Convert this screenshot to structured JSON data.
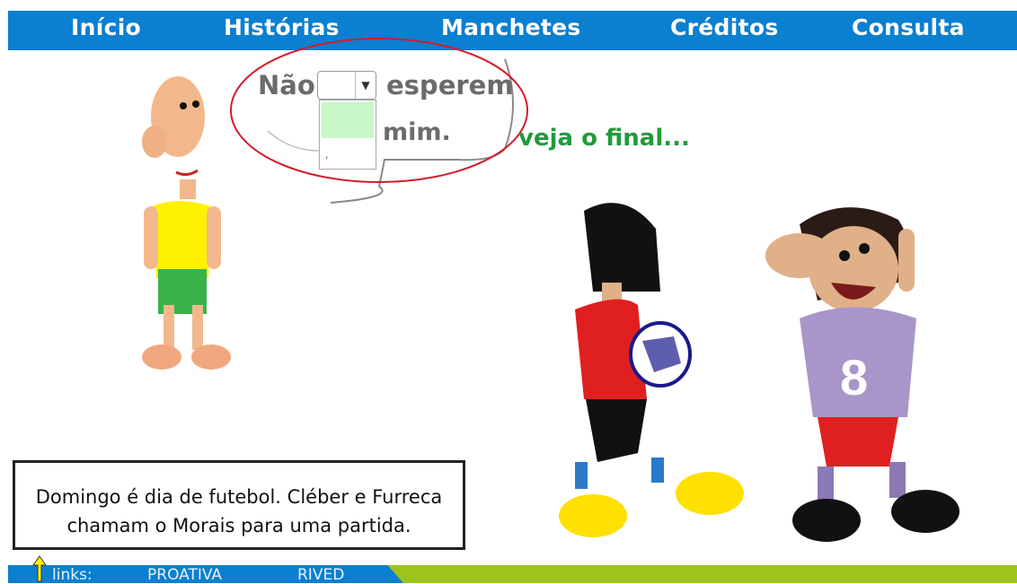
{
  "nav": {
    "items": [
      "Início",
      "Histórias",
      "Manchetes",
      "Créditos",
      "Consulta"
    ]
  },
  "bubble": {
    "word_before": "Não",
    "word_after": "esperem",
    "word_line2": "mim.",
    "dropdown_selected": "",
    "dropdown_option": ","
  },
  "hint": "veja o final...",
  "caption": {
    "line1": "Domingo é dia de futebol. Cléber e Furreca",
    "line2": "chamam o Morais para uma partida."
  },
  "footer": {
    "label": "links:",
    "link1": "PROATIVA",
    "link2": "RIVED"
  },
  "colors": {
    "nav": "#0b7fd0",
    "footer_green": "#9cc41c",
    "hint": "#1f9b3a",
    "annotation": "#d31c2a"
  }
}
